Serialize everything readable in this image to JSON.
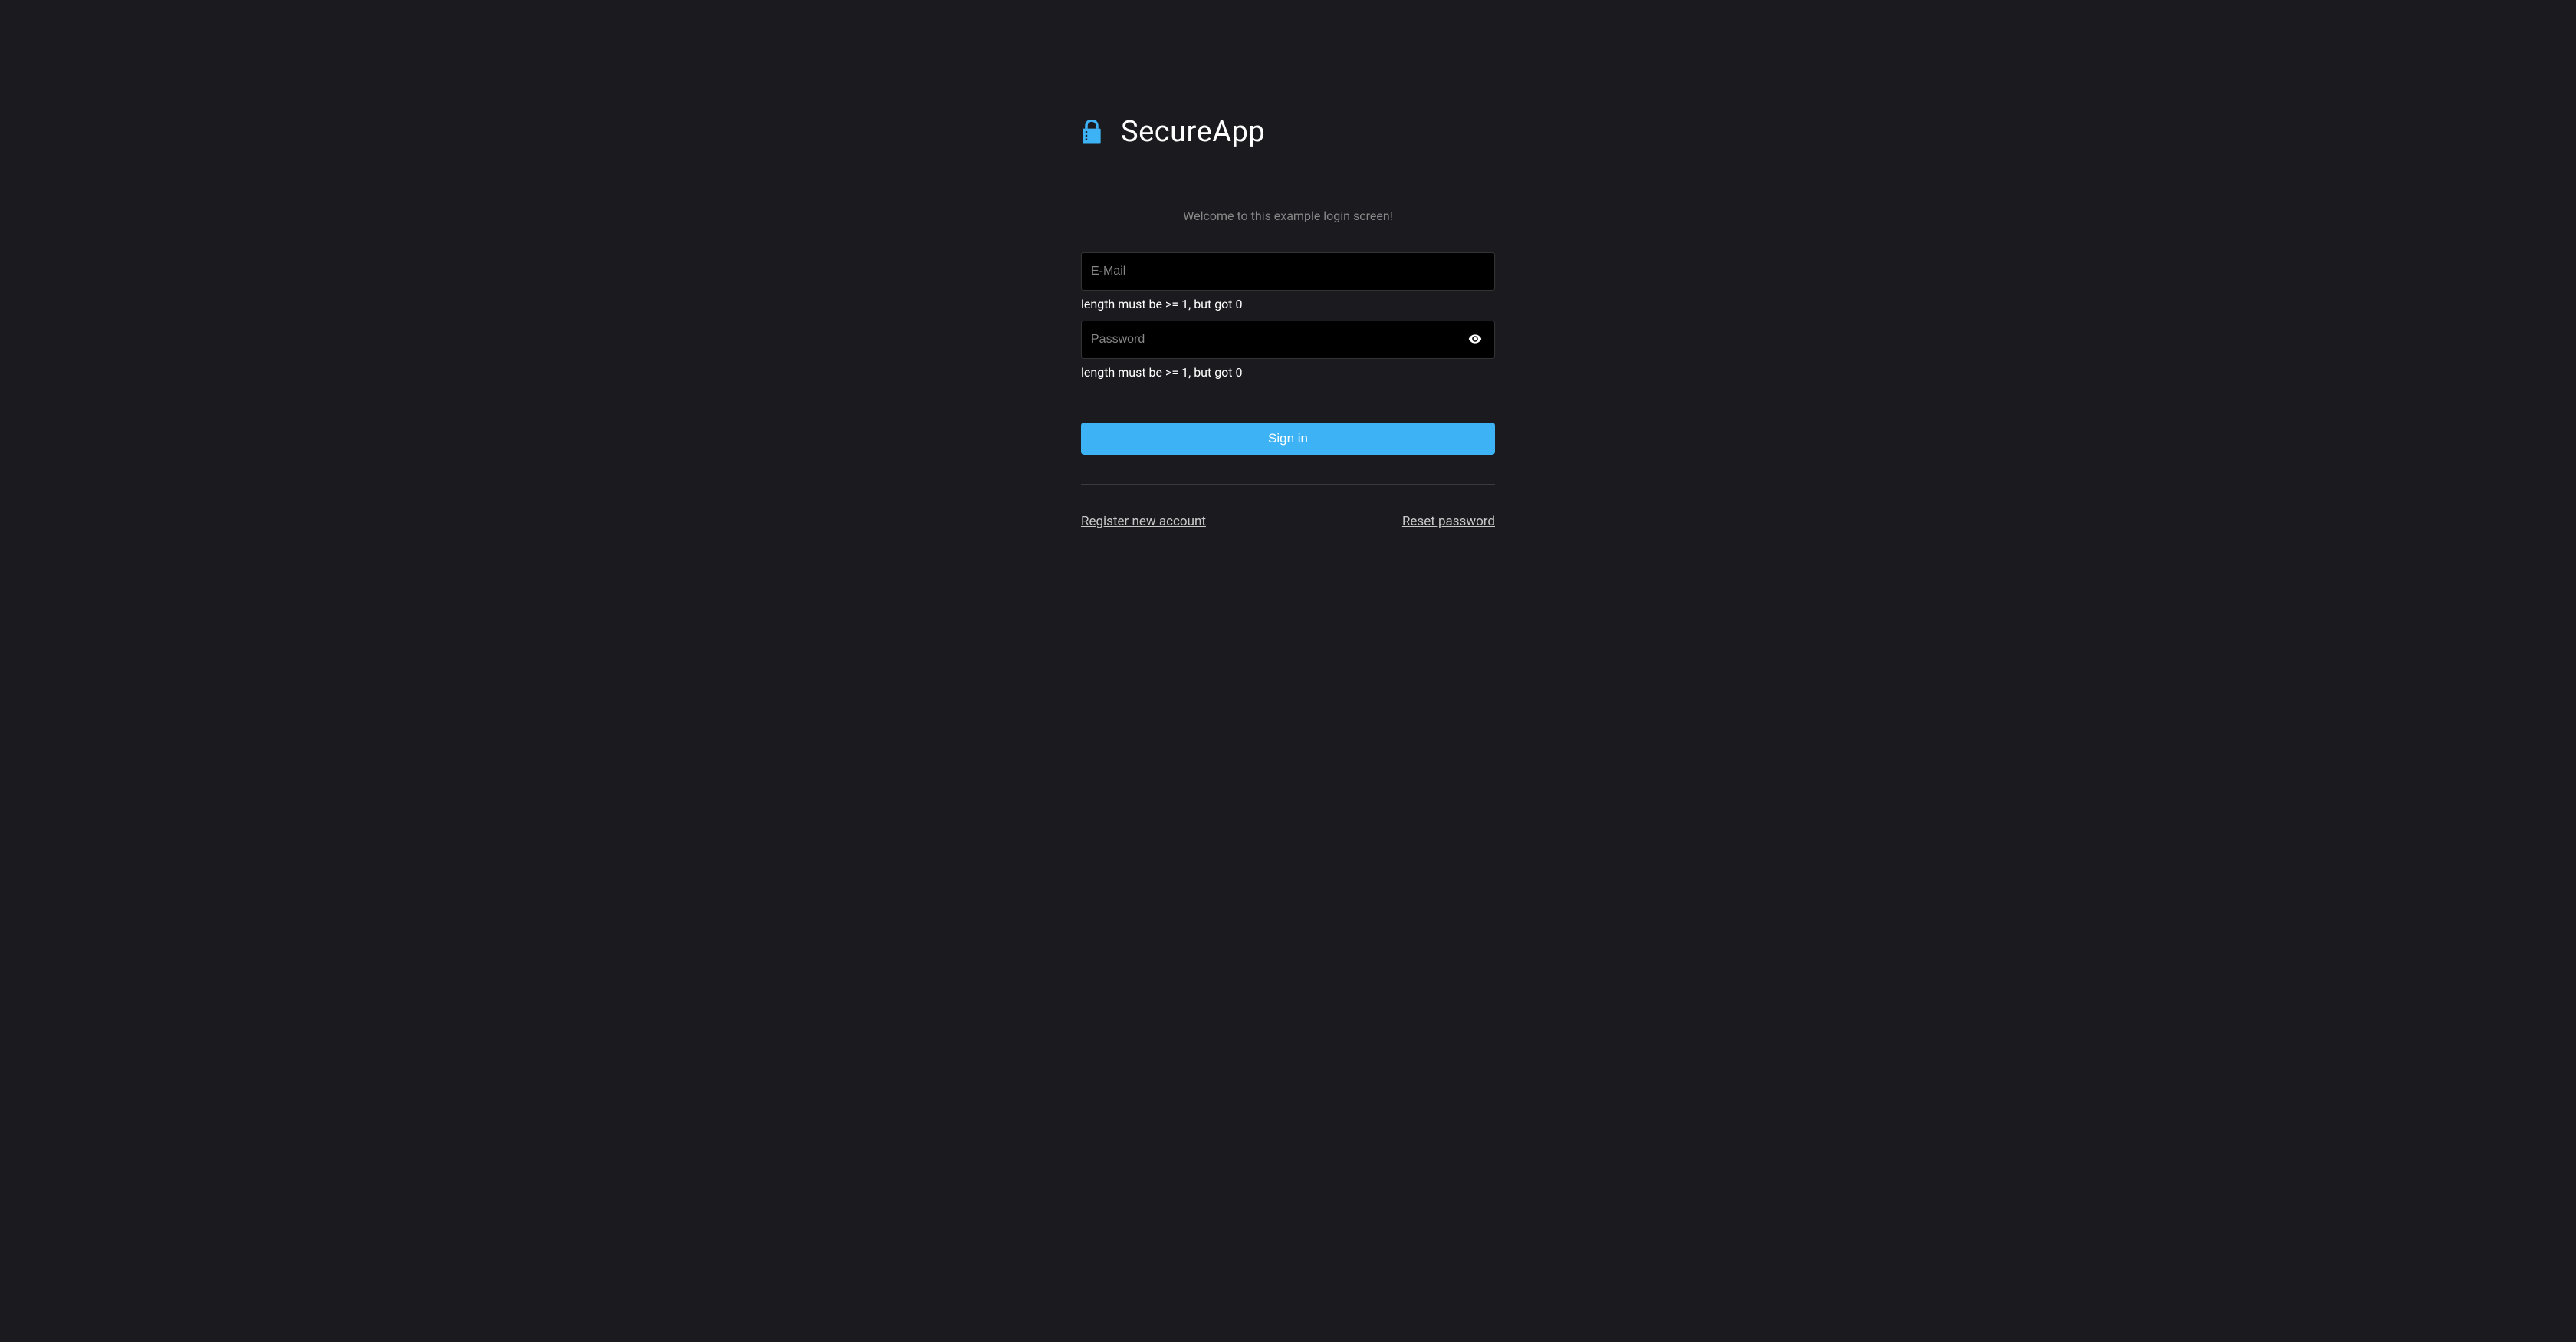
{
  "brand": {
    "title": "SecureApp"
  },
  "welcome": "Welcome to this example login screen!",
  "form": {
    "email": {
      "placeholder": "E-Mail",
      "value": "",
      "error": "length must be >= 1, but got 0"
    },
    "password": {
      "placeholder": "Password",
      "value": "",
      "error": "length must be >= 1, but got 0"
    },
    "submit_label": "Sign in"
  },
  "links": {
    "register": "Register new account",
    "reset": "Reset password"
  },
  "colors": {
    "accent": "#3db2f5",
    "background": "#1a1a1f",
    "input_bg": "#000000"
  }
}
